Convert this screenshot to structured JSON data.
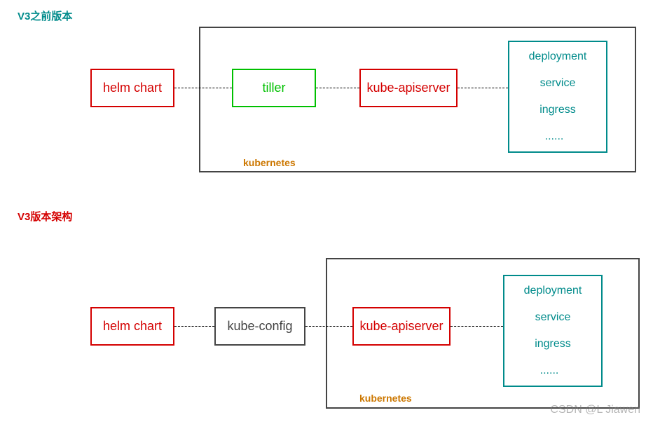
{
  "titles": {
    "v2": "V3之前版本",
    "v3": "V3版本架构"
  },
  "v2": {
    "helm": "helm chart",
    "tiller": "tiller",
    "kubeapi": "kube-apiserver",
    "k8s_label": "kubernetes",
    "resources": {
      "deployment": "deployment",
      "service": "service",
      "ingress": "ingress",
      "more": "......"
    }
  },
  "v3": {
    "helm": "helm chart",
    "kubeconfig": "kube-config",
    "kubeapi": "kube-apiserver",
    "k8s_label": "kubernetes",
    "resources": {
      "deployment": "deployment",
      "service": "service",
      "ingress": "ingress",
      "more": "......"
    }
  },
  "watermark": "CSDN @L Jiawen"
}
